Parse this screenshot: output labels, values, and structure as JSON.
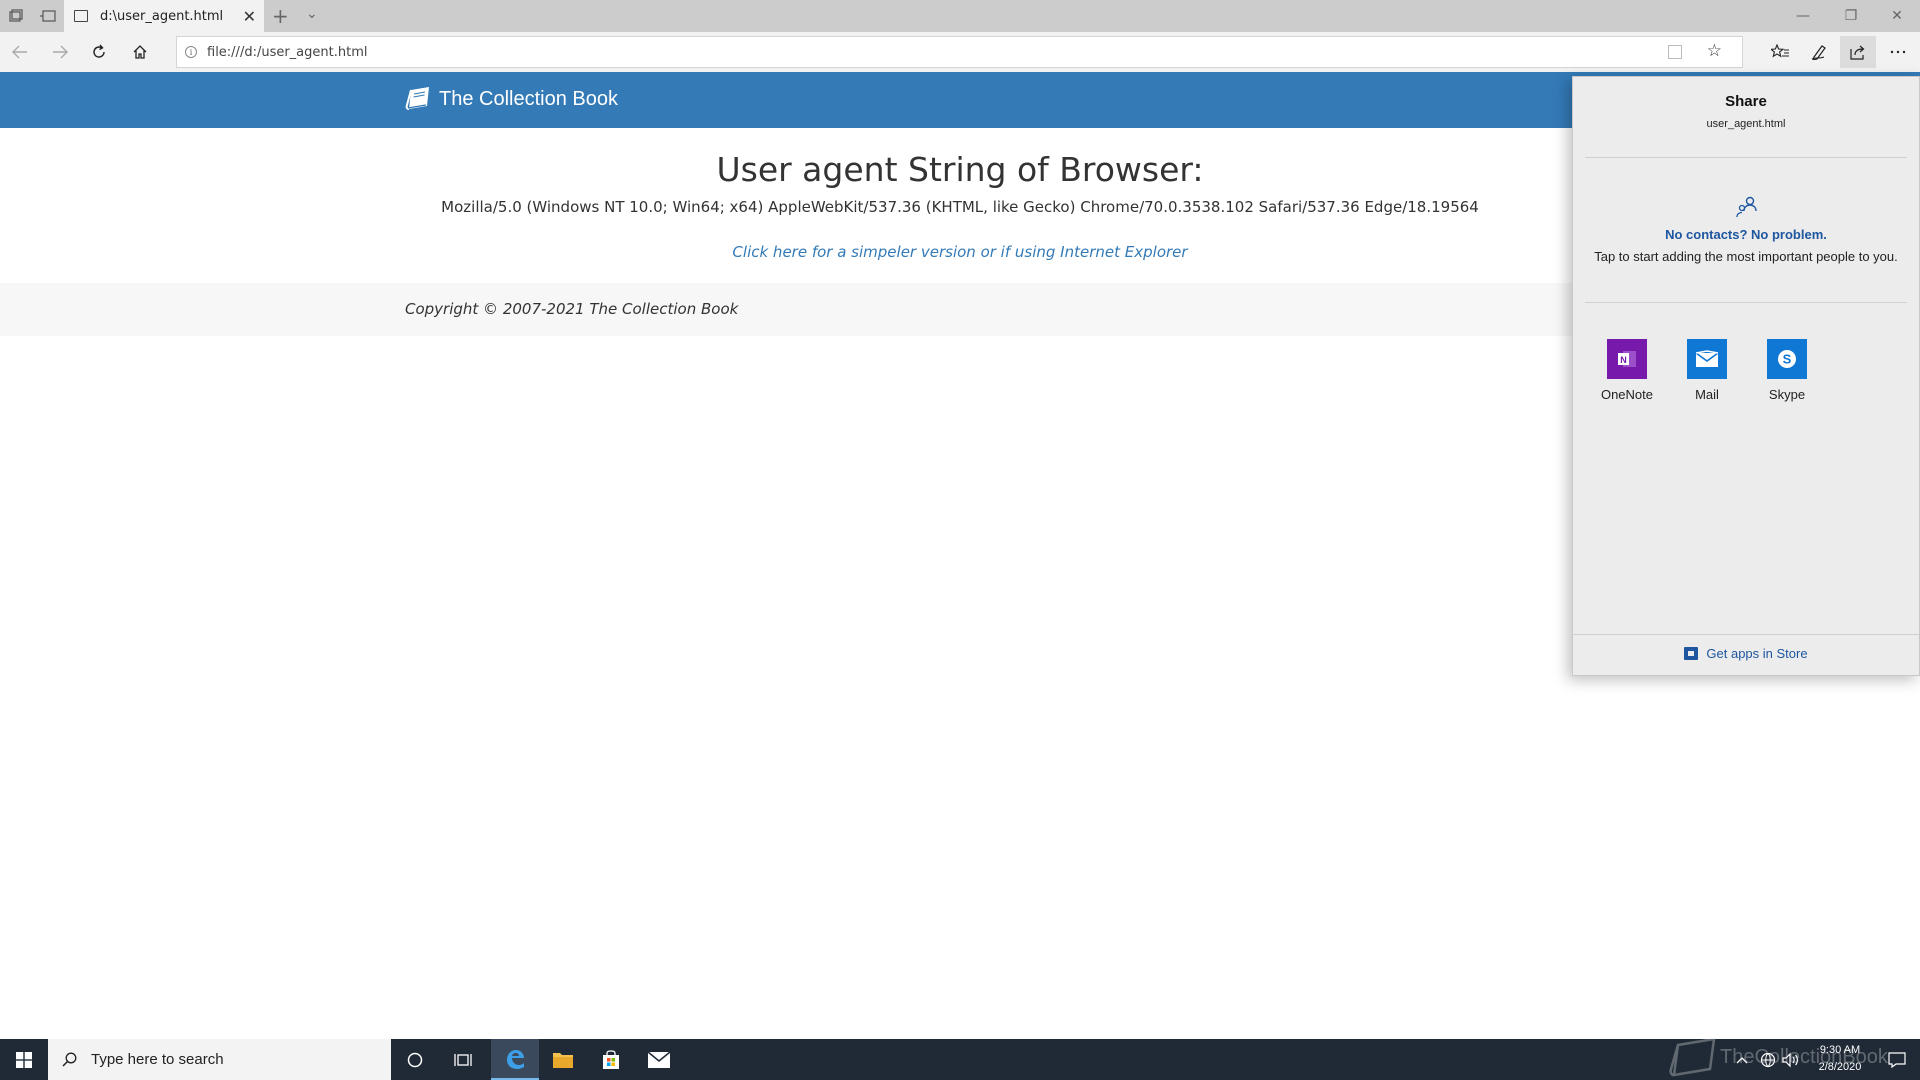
{
  "browser": {
    "tab_title": "d:\\user_agent.html",
    "tab_close": "✕",
    "new_tab": "+",
    "tab_list": "⌄",
    "address": "file:///d:/user_agent.html",
    "window_controls": {
      "minimize": "—",
      "restore": "❐",
      "close": "✕"
    },
    "icons": [
      "back-arrow-icon",
      "forward-arrow-icon",
      "refresh-icon",
      "home-icon",
      "reading-view-icon",
      "favorite-star-icon",
      "favorites-hub-icon",
      "pen-icon",
      "share-icon",
      "more-icon"
    ]
  },
  "site": {
    "brand": "The Collection Book",
    "brand_color": "#337ab7"
  },
  "content": {
    "title": "User agent String of Browser:",
    "user_agent": "Mozilla/5.0 (Windows NT 10.0; Win64; x64) AppleWebKit/537.36 (KHTML, like Gecko) Chrome/70.0.3538.102 Safari/537.36 Edge/18.19564",
    "ie_link": "Click here for a simpeler version or if using Internet Explorer",
    "footer": "Copyright © 2007-2021 The Collection Book"
  },
  "share": {
    "title": "Share",
    "file": "user_agent.html",
    "no_contacts": "No contacts? No problem.",
    "contacts_hint": "Tap to start adding the most important people to you.",
    "apps": [
      {
        "label": "OneNote",
        "color": "#7719aa",
        "icon": "onenote-icon"
      },
      {
        "label": "Mail",
        "color": "#0f78d4",
        "icon": "mail-icon"
      },
      {
        "label": "Skype",
        "color": "#0f78d4",
        "icon": "skype-icon"
      }
    ],
    "store_link": "Get apps in Store"
  },
  "taskbar": {
    "search_placeholder": "Type here to search",
    "time": "9:30 AM",
    "date": "2/8/2020",
    "watermark": "TheCollectionBook",
    "pinned": [
      "cortana-icon",
      "task-view-icon",
      "edge-icon",
      "file-explorer-icon",
      "store-icon",
      "mail-icon"
    ]
  }
}
